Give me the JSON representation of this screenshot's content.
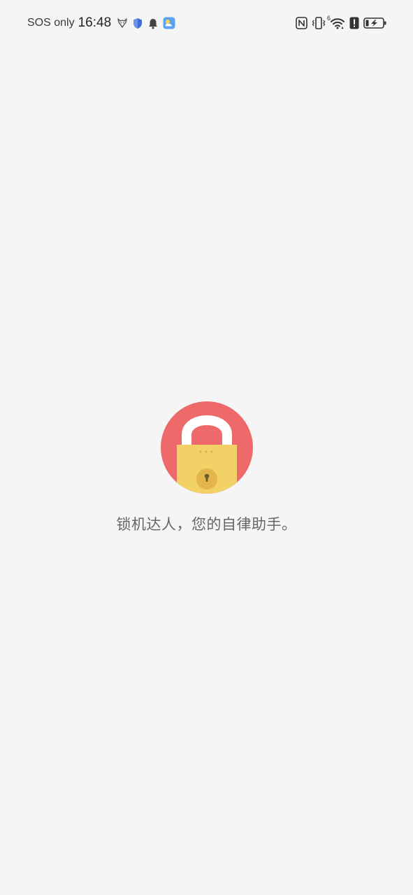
{
  "status_bar": {
    "network_text": "SOS only",
    "time": "16:48",
    "left_icons": [
      "wolf-icon",
      "shield-icon",
      "bell-icon",
      "weather-icon"
    ],
    "right_icons": [
      "nfc-icon",
      "vibrate-icon",
      "wifi-icon",
      "alert-icon",
      "battery-charging-icon"
    ],
    "wifi_badge": "6"
  },
  "splash": {
    "logo_icon": "padlock-icon",
    "tagline": "锁机达人，您的自律助手。"
  },
  "colors": {
    "background": "#f5f5f5",
    "logo_circle": "#ee6a6a",
    "lock_body": "#f4d166",
    "lock_shackle": "#ffffff",
    "keyhole_plate": "#e2b64a",
    "tagline_text": "#666666"
  }
}
